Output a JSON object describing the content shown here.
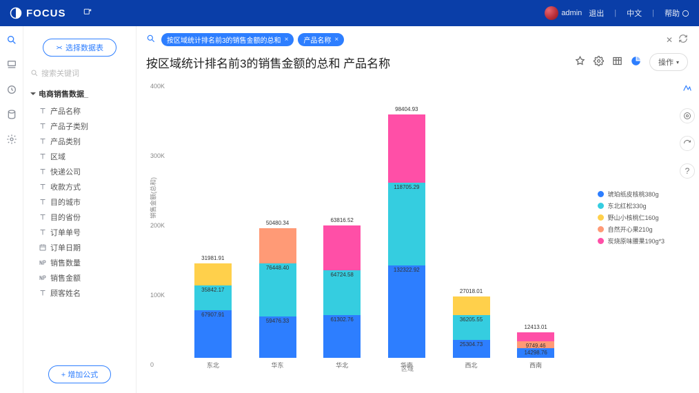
{
  "header": {
    "brand": "FOCUS",
    "user": "admin",
    "logout": "退出",
    "language": "中文",
    "help": "帮助"
  },
  "sidebar": {
    "select_table": "选择数据表",
    "search_placeholder": "搜索关键词",
    "add_formula": "+ 增加公式",
    "table_name": "电商销售数据_",
    "fields": [
      "产品名称",
      "产品子类别",
      "产品类别",
      "区域",
      "快递公司",
      "收款方式",
      "目的城市",
      "目的省份",
      "订单单号",
      "订单日期",
      "销售数量",
      "销售金额",
      "顾客姓名"
    ]
  },
  "query": {
    "chips": [
      "按区域统计排名前3的销售金额的总和",
      "产品名称"
    ]
  },
  "title": "按区域统计排名前3的销售金额的总和 产品名称",
  "ops_label": "操作",
  "chart_data": {
    "type": "bar",
    "stacked": true,
    "xlabel": "区域",
    "ylabel": "销售金额(总和)",
    "categories": [
      "东北",
      "华东",
      "华北",
      "华南",
      "西北",
      "西南"
    ],
    "ylim": [
      0,
      400000
    ],
    "yticks": [
      0,
      100000,
      200000,
      300000,
      400000
    ],
    "ytick_labels": [
      "0",
      "100K",
      "200K",
      "300K",
      "400K"
    ],
    "series": [
      {
        "name": "琥珀纸皮核桃380g",
        "color": "#2d7eff"
      },
      {
        "name": "东北红松330g",
        "color": "#35cde0"
      },
      {
        "name": "野山小核桃仁160g",
        "color": "#ffd04b"
      },
      {
        "name": "自然开心果210g",
        "color": "#ff9a76"
      },
      {
        "name": "炭烧原味腰果190g*3",
        "color": "#ff4fa7"
      }
    ],
    "stacks": [
      [
        {
          "series": 0,
          "value": 67907.91
        },
        {
          "series": 1,
          "value": 35842.17
        },
        {
          "series": 2,
          "value": 31981.91
        }
      ],
      [
        {
          "series": 0,
          "value": 59476.33
        },
        {
          "series": 1,
          "value": 76448.4
        },
        {
          "series": 3,
          "value": 50480.34
        }
      ],
      [
        {
          "series": 0,
          "value": 61302.76
        },
        {
          "series": 1,
          "value": 64724.58
        },
        {
          "series": 4,
          "value": 63816.52
        }
      ],
      [
        {
          "series": 0,
          "value": 132322.92
        },
        {
          "series": 1,
          "value": 118705.29
        },
        {
          "series": 4,
          "value": 98404.93
        }
      ],
      [
        {
          "series": 0,
          "value": 25304.73
        },
        {
          "series": 1,
          "value": 36205.55
        },
        {
          "series": 2,
          "value": 27018.01
        }
      ],
      [
        {
          "series": 0,
          "value": 14298.76
        },
        {
          "series": 3,
          "value": 9749.46
        },
        {
          "series": 4,
          "value": 12413.01
        }
      ]
    ]
  }
}
